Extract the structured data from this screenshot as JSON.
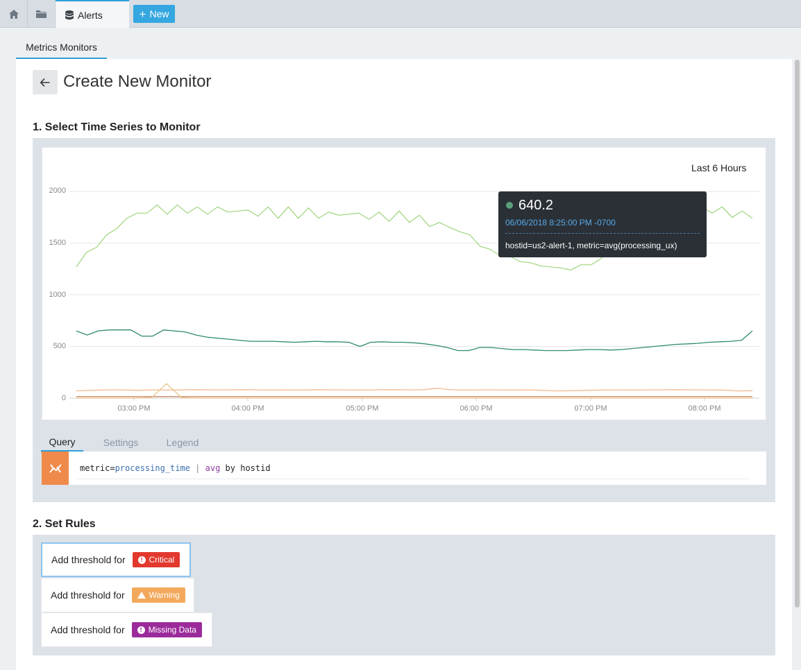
{
  "topbar": {
    "icons": [
      "home-icon",
      "folder-icon",
      "database-icon"
    ],
    "active_tab": "Alerts",
    "new_button": "New"
  },
  "subtab": "Metrics Monitors",
  "page": {
    "title": "Create New Monitor"
  },
  "section1": {
    "title": "1. Select Time Series to Monitor",
    "range": "Last 6 Hours"
  },
  "chart_data": {
    "type": "line",
    "title": "",
    "y_ticks": [
      "2000",
      "1500",
      "1000",
      "500",
      "0"
    ],
    "x_ticks": [
      "03:00 PM",
      "04:00 PM",
      "05:00 PM",
      "06:00 PM",
      "07:00 PM",
      "08:00 PM"
    ],
    "ylim": [
      0,
      2000
    ],
    "grid": true,
    "series_colors": [
      "#9ed47a",
      "#2f8a6c",
      "#f2b98f",
      "#e9c38a",
      "#c98a6b"
    ],
    "series": [
      {
        "values": [
          1270,
          1410,
          1460,
          1580,
          1640,
          1740,
          1790,
          1790,
          1870,
          1780,
          1870,
          1790,
          1850,
          1780,
          1850,
          1800,
          1810,
          1820,
          1760,
          1850,
          1740,
          1850,
          1740,
          1840,
          1740,
          1800,
          1770,
          1780,
          1790,
          1730,
          1800,
          1710,
          1810,
          1700,
          1770,
          1660,
          1700,
          1650,
          1610,
          1580,
          1470,
          1440,
          1380,
          1370,
          1320,
          1310,
          1280,
          1270,
          1260,
          1240,
          1290,
          1290,
          1350,
          1450,
          1580,
          1640,
          1750,
          1800,
          1790,
          1820,
          1800,
          1750,
          1850,
          1790,
          1850,
          1750,
          1810,
          1740
        ]
      },
      {
        "values": [
          650,
          610,
          650,
          660,
          660,
          660,
          600,
          600,
          660,
          650,
          640,
          610,
          590,
          580,
          570,
          560,
          550,
          550,
          550,
          545,
          540,
          545,
          550,
          545,
          545,
          540,
          500,
          540,
          545,
          540,
          540,
          535,
          525,
          510,
          490,
          460,
          460,
          490,
          490,
          480,
          470,
          470,
          465,
          460,
          460,
          460,
          465,
          470,
          470,
          465,
          470,
          480,
          490,
          500,
          510,
          520,
          525,
          530,
          540,
          545,
          550,
          560,
          650
        ]
      },
      {
        "values": [
          70,
          75,
          80,
          80,
          75,
          80,
          78,
          80,
          82,
          80,
          80,
          82,
          80,
          78,
          80,
          78,
          82,
          80,
          80,
          78,
          80,
          82,
          80,
          80,
          95,
          80,
          78,
          80,
          80,
          78,
          80,
          75,
          70,
          72,
          75,
          78,
          80,
          78,
          80,
          80,
          82,
          80,
          80,
          78,
          70,
          72
        ]
      },
      {
        "values": [
          0,
          0,
          0,
          0,
          0,
          5,
          140,
          5,
          0,
          0,
          0,
          0,
          0,
          0,
          0,
          0,
          0,
          0,
          0,
          0,
          0,
          0,
          0,
          0,
          0,
          0,
          0,
          0,
          0,
          0,
          0,
          0,
          0,
          0,
          0,
          0,
          0,
          0,
          0,
          0,
          0,
          0,
          0,
          0,
          0,
          0
        ]
      },
      {
        "values": [
          15,
          15,
          15,
          15,
          15,
          15,
          15,
          15,
          15,
          15,
          15,
          15,
          15,
          15,
          15,
          15,
          15,
          15,
          15,
          15,
          15,
          15,
          15,
          15,
          15,
          15,
          15,
          15,
          15,
          15,
          15,
          15,
          15,
          15,
          15,
          15,
          15,
          15,
          15,
          15,
          15,
          15,
          15,
          15,
          15,
          15
        ]
      }
    ]
  },
  "tooltip": {
    "value": "640.2",
    "timestamp": "06/06/2018 8:25:00 PM -0700",
    "series": "hostid=us2-alert-1, metric=avg(processing_ux)"
  },
  "query_tabs": [
    "Query",
    "Settings",
    "Legend"
  ],
  "query": {
    "prefix": "metric=",
    "metric": "processing_time",
    "pipe": " | ",
    "fn": "avg",
    "suffix": " by hostid"
  },
  "section2": {
    "title": "2. Set Rules",
    "rules": [
      {
        "label": "Add threshold for",
        "badge": "Critical"
      },
      {
        "label": "Add threshold for",
        "badge": "Warning"
      },
      {
        "label": "Add threshold for",
        "badge": "Missing Data"
      }
    ]
  }
}
